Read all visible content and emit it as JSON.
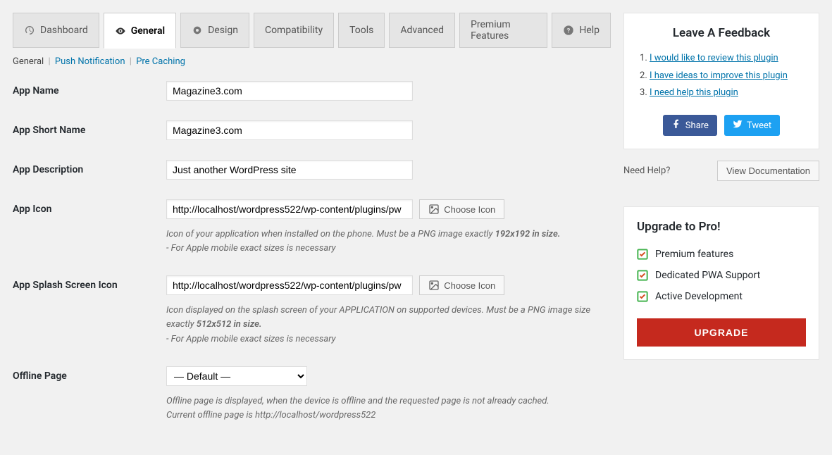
{
  "tabs": {
    "dashboard": "Dashboard",
    "general": "General",
    "design": "Design",
    "compatibility": "Compatibility",
    "tools": "Tools",
    "advanced": "Advanced",
    "premium": "Premium Features",
    "help": "Help"
  },
  "subnav": {
    "general": "General",
    "push": "Push Notification",
    "precache": "Pre Caching"
  },
  "fields": {
    "appName": {
      "label": "App Name",
      "value": "Magazine3.com"
    },
    "appShortName": {
      "label": "App Short Name",
      "value": "Magazine3.com"
    },
    "appDescription": {
      "label": "App Description",
      "value": "Just another WordPress site"
    },
    "appIcon": {
      "label": "App Icon",
      "value": "http://localhost/wordpress522/wp-content/plugins/pw",
      "button": "Choose Icon",
      "help1": "Icon of your application when installed on the phone. Must be a PNG image exactly ",
      "help1b": "192x192 in size.",
      "help2": "- For Apple mobile exact sizes is necessary"
    },
    "splashIcon": {
      "label": "App Splash Screen Icon",
      "value": "http://localhost/wordpress522/wp-content/plugins/pw",
      "button": "Choose Icon",
      "help1": "Icon displayed on the splash screen of your APPLICATION on supported devices. Must be a PNG image size exactly ",
      "help1b": "512x512 in size.",
      "help2": "- For Apple mobile exact sizes is necessary"
    },
    "offlinePage": {
      "label": "Offline Page",
      "value": "— Default —",
      "help1": "Offline page is displayed, when the device is offline and the requested page is not already cached.",
      "help2": "Current offline page is http://localhost/wordpress522"
    }
  },
  "feedback": {
    "title": "Leave A Feedback",
    "items": [
      "I would like to review this plugin",
      "I have ideas to improve this plugin",
      "I need help this plugin"
    ],
    "share": "Share",
    "tweet": "Tweet"
  },
  "helpRow": {
    "label": "Need Help?",
    "button": "View Documentation"
  },
  "pro": {
    "title": "Upgrade to Pro!",
    "items": [
      "Premium features",
      "Dedicated PWA Support",
      "Active Development"
    ],
    "button": "UPGRADE"
  }
}
